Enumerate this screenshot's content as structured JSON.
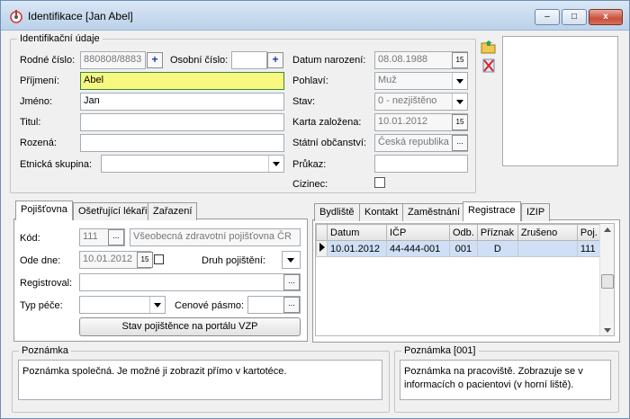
{
  "window": {
    "title": "Identifikace [Jan Abel]",
    "min_label": "–",
    "max_label": "□",
    "close_label": "x"
  },
  "ident": {
    "group_title": "Identifikační údaje",
    "rodne_cislo_label": "Rodné číslo:",
    "rodne_cislo_value": "880808/8883",
    "osobni_cislo_label": "Osobní číslo:",
    "osobni_cislo_value": "",
    "prijmeni_label": "Příjmení:",
    "prijmeni_value": "Abel",
    "jmeno_label": "Jméno:",
    "jmeno_value": "Jan",
    "titul_label": "Titul:",
    "titul_value": "",
    "rozena_label": "Rozená:",
    "rozena_value": "",
    "etnicka_label": "Etnická skupina:",
    "etnicka_value": "",
    "datum_narozeni_label": "Datum narození:",
    "datum_narozeni_value": "08.08.1988",
    "pohlavi_label": "Pohlaví:",
    "pohlavi_value": "Muž",
    "stav_label": "Stav:",
    "stav_value": "0 - nezjištěno",
    "karta_label": "Karta založena:",
    "karta_value": "10.01.2012",
    "obcanstvi_label": "Státní občanství:",
    "obcanstvi_value": "Česká republika",
    "prukaz_label": "Průkaz:",
    "prukaz_value": "",
    "cizinec_label": "Cizinec:",
    "plus": "+",
    "calendar": "15",
    "ellipsis": "..."
  },
  "left_tabs": {
    "tabs": [
      "Pojišťovna",
      "Ošetřující lékaři",
      "Zařazení"
    ],
    "kod_label": "Kód:",
    "kod_value": "111",
    "pojistovna_name": "Všeobecná zdravotní pojišťovna ČR",
    "ode_dne_label": "Ode dne:",
    "ode_dne_value": "10.01.2012",
    "druh_label": "Druh pojištění:",
    "registroval_label": "Registroval:",
    "typ_pece_label": "Typ péče:",
    "cenove_label": "Cenové pásmo:",
    "portal_button": "Stav pojištěnce na portálu VZP"
  },
  "right_tabs": {
    "tabs": [
      "Bydliště",
      "Kontakt",
      "Zaměstnání",
      "Registrace",
      "IZIP"
    ],
    "columns": [
      "Datum",
      "IČP",
      "Odb.",
      "Příznak",
      "Zrušeno",
      "Poj."
    ],
    "rows": [
      {
        "datum": "10.01.2012",
        "icp": "44-444-001",
        "odb": "001",
        "priznak": "D",
        "zruseno": "",
        "poj": "111"
      }
    ]
  },
  "notes": {
    "left_title": "Poznámka",
    "left_text": "Poznámka společná. Je možné ji zobrazit přímo v kartotéce.",
    "right_title": "Poznámka [001]",
    "right_text": "Poznámka na pracoviště. Zobrazuje se v informacích o pacientovi (v horní liště)."
  },
  "colors": {
    "highlight_field": "#f8f881",
    "selected_row": "#cfe0f6"
  }
}
